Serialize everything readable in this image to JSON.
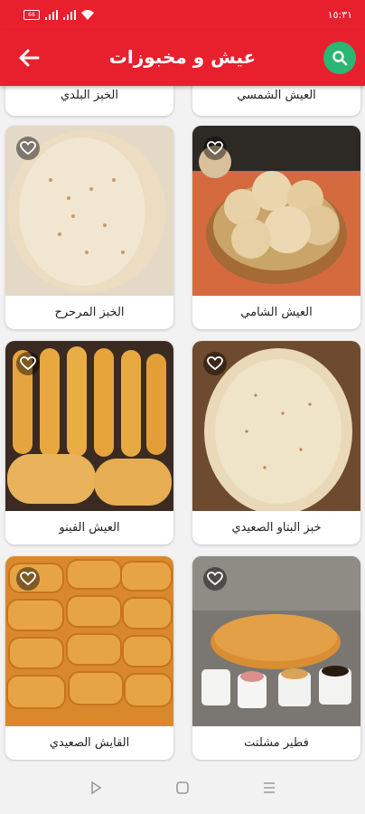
{
  "status_bar": {
    "time": "١٥:٣١",
    "battery": "66"
  },
  "app_bar": {
    "title": "عيش و مخبوزات",
    "back_icon": "arrow-back-icon",
    "search_icon": "search-icon"
  },
  "colors": {
    "primary": "#e8202e",
    "search_button": "#2bb673"
  },
  "items": [
    {
      "name": "العيش الشمسي"
    },
    {
      "name": "الخبز البلدي"
    },
    {
      "name": "العيش الشامي"
    },
    {
      "name": "الخبز المرحرح"
    },
    {
      "name": "خبز البتاو الصعيدي"
    },
    {
      "name": "العيش الفينو"
    },
    {
      "name": "فطير مشلتت"
    },
    {
      "name": "القايش الصعيدي"
    }
  ]
}
